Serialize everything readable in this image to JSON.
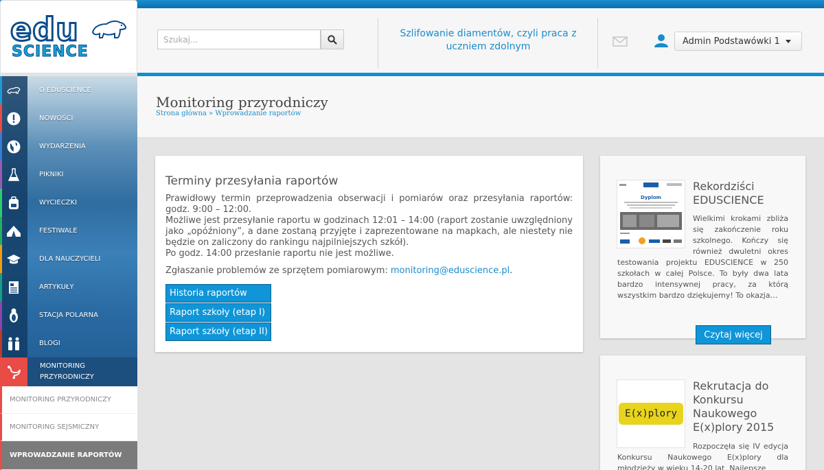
{
  "logo": {
    "line1": "edu",
    "line2": "SCIENCE"
  },
  "search": {
    "placeholder": "Szukaj..."
  },
  "headline": "Szlifowanie diamentów, czyli praca z uczniem zdolnym",
  "user": {
    "name": "Admin Podstawówki 1"
  },
  "sidebar": {
    "items": [
      {
        "label": "O EDUSCIENCE",
        "icon": "bear-icon",
        "color": "#1e9bd7"
      },
      {
        "label": "NOWOŚCI",
        "icon": "exclamation-icon",
        "color": "#e94b46"
      },
      {
        "label": "WYDARZENIA",
        "icon": "globe-icon",
        "color": "#3a7bd5"
      },
      {
        "label": "PIKNIKI",
        "icon": "flask-icon",
        "color": "#9b59b6"
      },
      {
        "label": "WYCIECZKI",
        "icon": "backpack-icon",
        "color": "#2ecc71"
      },
      {
        "label": "FESTIWALE",
        "icon": "tent-icon",
        "color": "#27ae60"
      },
      {
        "label": "DLA NAUCZYCIELI",
        "icon": "graduation-cap-icon",
        "color": "#f39c12"
      },
      {
        "label": "ARTYKUŁY",
        "icon": "newspaper-icon",
        "color": "#16a085"
      },
      {
        "label": "STACJA POLARNA",
        "icon": "penguin-icon",
        "color": "#8e44ad"
      },
      {
        "label": "BLOGI",
        "icon": "people-icon",
        "color": "#c0392b"
      }
    ],
    "active": {
      "label": "MONITORING PRZYRODNICZY",
      "icon": "bird-icon"
    },
    "subitems": [
      {
        "label": "MONITORING PRZYRODNICZY"
      },
      {
        "label": "MONITORING SEJSMICZNY"
      },
      {
        "label": "WPROWADZANIE RAPORTÓW"
      }
    ]
  },
  "page": {
    "title": "Monitoring przyrodniczy",
    "breadcrumb": "Strona główna » Wprowadzanie raportów"
  },
  "main_card": {
    "title": "Terminy przesyłania raportów",
    "para1": "Prawidłowy termin przeprowadzenia obserwacji i pomiarów oraz przesyłania raportów: godz. 9:00 – 12:00.",
    "para2": "Możliwe jest przesyłanie raportu w godzinach 12:01 – 14:00 (raport zostanie uwzględniony jako „opóźniony”, a dane zostaną przyjęte i zaprezentowane na mapkach, ale niestety nie będzie on zaliczony do rankingu najpilniejszych szkół).",
    "para3": "Po godz. 14:00 przesłanie raportu nie jest możliwe.",
    "problems_text": "Zgłaszanie problemów ze sprzętem pomiarowym: ",
    "email": "monitoring@eduscience.pl",
    "email_suffix": ".",
    "buttons": [
      "Historia raportów",
      "Raport szkoły (etap I)",
      "Raport szkoły (etap II)"
    ]
  },
  "news": [
    {
      "title": "Rekordziści EDUSCIENCE",
      "text": "Wielkimi krokami zbliża się zakończenie roku szkolnego. Kończy się również dwuletni okres testowania projektu EDUSCIENCE w 250 szkołach w całej Polsce. To były dwa lata bardzo intensywnej pracy, za którą wszystkim bardzo dziękujemy! To okazja…",
      "thumb_title": "Dyplom",
      "read_more": "Czytaj więcej"
    },
    {
      "title": "Rekrutacja do Konkursu Naukowego E(x)plory 2015",
      "text": "Rozpoczęła się IV edycja Konkursu Naukowego E(x)plory dla młodzieży w wieku 14-20 lat. Najlepsze",
      "thumb_text": "E(x)plory"
    }
  ],
  "colors": {
    "accent": "#0f95d8",
    "active": "#e94b46",
    "link": "#1a8ccd"
  }
}
